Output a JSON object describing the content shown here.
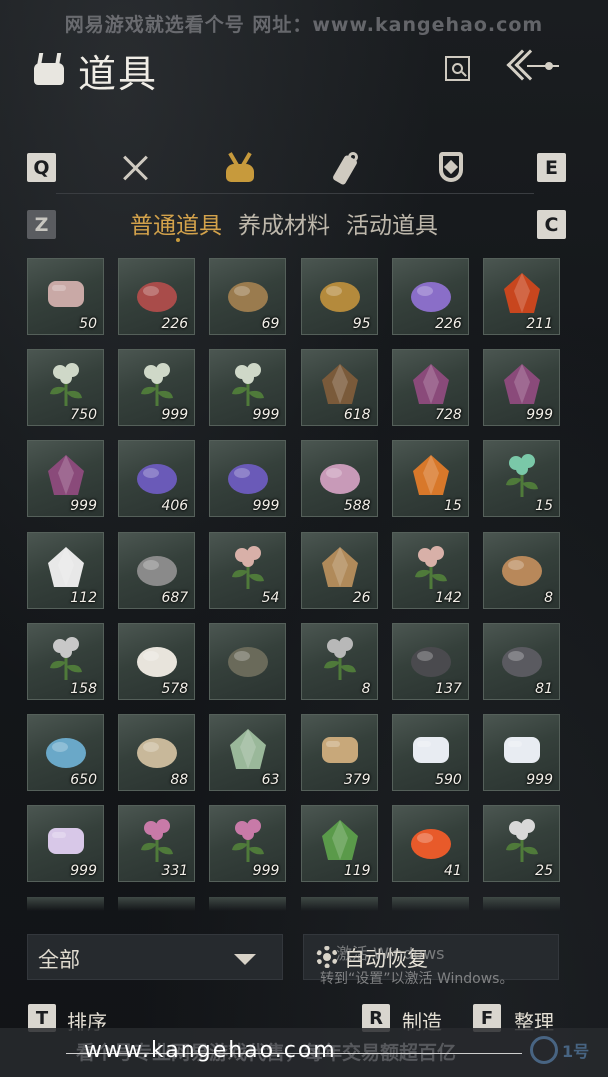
{
  "watermark_top": "网易游戏就选看个号   网址：www.kangehao.com",
  "header": {
    "title": "道具",
    "title_icon": "item-bag-icon",
    "search_icon": "search-icon",
    "back_icon": "back-arrow-icon"
  },
  "categories": {
    "key_left": "Q",
    "key_right": "E",
    "icons": [
      "crossed-swords-icon",
      "item-bag-icon",
      "scroll-icon",
      "shield-icon"
    ],
    "active_index": 1,
    "accent_color": "#d3a24b"
  },
  "subtabs": {
    "key_left": "Z",
    "key_right": "C",
    "items": [
      {
        "label": "普通道具",
        "active": true
      },
      {
        "label": "养成材料",
        "active": false
      },
      {
        "label": "活动道具",
        "active": false
      }
    ]
  },
  "items": [
    {
      "name": "meat-strips",
      "qty": "50"
    },
    {
      "name": "raw-beef",
      "qty": "226"
    },
    {
      "name": "fish",
      "qty": "69"
    },
    {
      "name": "gold-ore",
      "qty": "95"
    },
    {
      "name": "amethyst",
      "qty": "226"
    },
    {
      "name": "red-agate",
      "qty": "211"
    },
    {
      "name": "white-herb",
      "qty": "750"
    },
    {
      "name": "white-herb",
      "qty": "999"
    },
    {
      "name": "white-herb",
      "qty": "999"
    },
    {
      "name": "herb-bowl",
      "qty": "618"
    },
    {
      "name": "purple-flower",
      "qty": "728"
    },
    {
      "name": "purple-flower",
      "qty": "999"
    },
    {
      "name": "purple-flower",
      "qty": "999"
    },
    {
      "name": "lavender",
      "qty": "406"
    },
    {
      "name": "lavender",
      "qty": "999"
    },
    {
      "name": "pink-blossom",
      "qty": "588"
    },
    {
      "name": "orange-flower",
      "qty": "15"
    },
    {
      "name": "jade-stone",
      "qty": "15"
    },
    {
      "name": "white-feather",
      "qty": "112"
    },
    {
      "name": "dark-feather",
      "qty": "687"
    },
    {
      "name": "raw-meat-paper",
      "qty": "54"
    },
    {
      "name": "soup-bowl",
      "qty": "26"
    },
    {
      "name": "raw-meat-paper",
      "qty": "142"
    },
    {
      "name": "fur-pelt",
      "qty": "8"
    },
    {
      "name": "quills",
      "qty": "158"
    },
    {
      "name": "white-fleece",
      "qty": "578"
    },
    {
      "name": "spotted-fish",
      "qty": ""
    },
    {
      "name": "small-fish",
      "qty": "8"
    },
    {
      "name": "coal",
      "qty": "137"
    },
    {
      "name": "dark-ore",
      "qty": "81"
    },
    {
      "name": "blue-ore",
      "qty": "650"
    },
    {
      "name": "bone",
      "qty": "88"
    },
    {
      "name": "melon",
      "qty": "63"
    },
    {
      "name": "grain-sacks",
      "qty": "379"
    },
    {
      "name": "white-chrysanthemum",
      "qty": "590"
    },
    {
      "name": "white-chrysanthemum",
      "qty": "999"
    },
    {
      "name": "lilac-chrysanthemum",
      "qty": "999"
    },
    {
      "name": "pink-chrysanthemum",
      "qty": "331"
    },
    {
      "name": "pink-chrysanthemum",
      "qty": "999"
    },
    {
      "name": "mint-herb",
      "qty": "119"
    },
    {
      "name": "koi-fish",
      "qty": "41"
    },
    {
      "name": "shrimp",
      "qty": "25"
    }
  ],
  "item_colors": {
    "meat-strips": "#c9a9a6",
    "raw-beef": "#a94c4a",
    "fish": "#9a7b4e",
    "gold-ore": "#b48a3c",
    "amethyst": "#8a6ec8",
    "red-agate": "#c8461e",
    "white-herb": "#cfd8c8",
    "herb-bowl": "#7a5a3a",
    "purple-flower": "#8a4a7a",
    "lavender": "#6a5ab8",
    "pink-blossom": "#c89ab8",
    "orange-flower": "#d8782a",
    "jade-stone": "#7ac8a8",
    "white-feather": "#e8e8e8",
    "dark-feather": "#8a8a8a",
    "raw-meat-paper": "#d8b0a8",
    "soup-bowl": "#b08a5a",
    "fur-pelt": "#b8885a",
    "quills": "#c8c8c8",
    "white-fleece": "#e8e4dc",
    "spotted-fish": "#6a6a5a",
    "small-fish": "#b8b8b8",
    "coal": "#4a4a4e",
    "dark-ore": "#5a5a60",
    "blue-ore": "#6aa8c8",
    "bone": "#c8b89a",
    "melon": "#9ab89a",
    "grain-sacks": "#c8a87a",
    "white-chrysanthemum": "#e8ecf2",
    "lilac-chrysanthemum": "#d8c8e8",
    "pink-chrysanthemum": "#c87aa8",
    "mint-herb": "#5a9a4a",
    "koi-fish": "#e85a2a",
    "shrimp": "#d8d8d8"
  },
  "footer": {
    "filter_label": "全部",
    "filter_icon": "chevron-down-icon",
    "auto_restore_label": "自动恢复",
    "auto_restore_icon": "gear-icon",
    "windows_activate_1": "激活 Windows",
    "windows_activate_2": "转到“设置”以激活 Windows。",
    "sort_key": "T",
    "sort_label": "排序",
    "craft_key": "R",
    "craft_label": "制造",
    "tidy_key": "F",
    "tidy_label": "整理"
  },
  "watermark_bottom": {
    "faint_text": "看个号专业网易游戏代售，每年交易额超百亿",
    "url": "www.kangehao.com",
    "badge_text": "1号"
  }
}
